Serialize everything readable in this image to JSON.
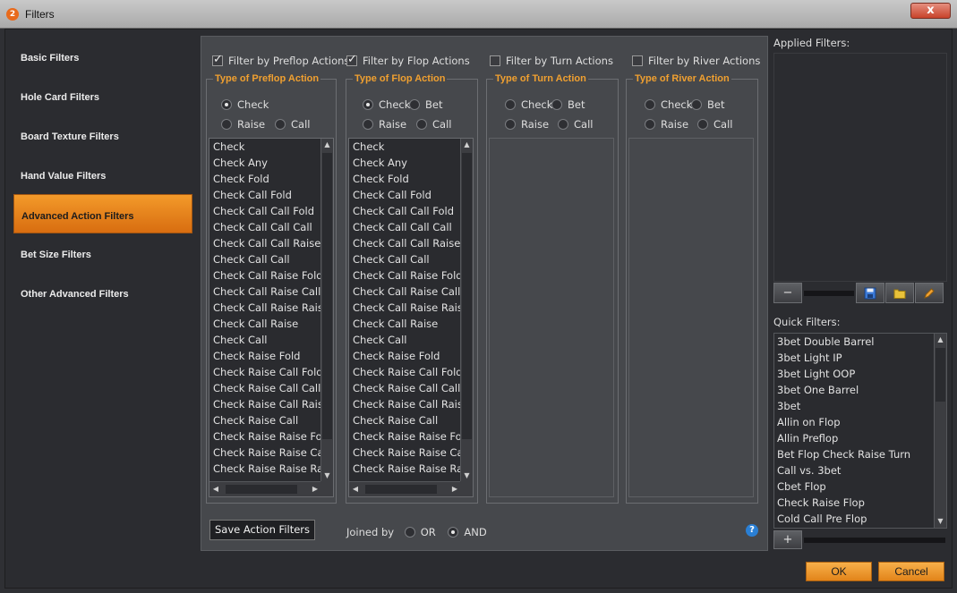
{
  "window": {
    "title": "Filters",
    "app_badge": "2",
    "close_label": "x"
  },
  "nav": {
    "items": [
      {
        "label": "Basic Filters"
      },
      {
        "label": "Hole Card Filters"
      },
      {
        "label": "Board Texture Filters"
      },
      {
        "label": "Hand Value Filters"
      },
      {
        "label": "Advanced Action Filters",
        "active": true
      },
      {
        "label": "Bet Size Filters"
      },
      {
        "label": "Other Advanced Filters"
      }
    ]
  },
  "streets": [
    {
      "checkbox_label": "Filter by Preflop Actions",
      "checked": true,
      "group_title": "Type of Preflop Action",
      "radios": [
        {
          "label": "Check",
          "selected": true
        },
        {
          "label": "Raise"
        },
        {
          "label": "Call"
        }
      ],
      "actions": [
        "Check",
        "Check Any",
        "Check Fold",
        "Check Call Fold",
        "Check Call Call Fold",
        "Check Call Call Call",
        "Check Call Call Raise",
        "Check Call Call",
        "Check Call Raise Fold",
        "Check Call Raise Call",
        "Check Call Raise Raise",
        "Check Call Raise",
        "Check Call",
        "Check Raise Fold",
        "Check Raise Call Fold",
        "Check Raise Call Call",
        "Check Raise Call Raise",
        "Check Raise Call",
        "Check Raise Raise Fold",
        "Check Raise Raise Call",
        "Check Raise Raise Raise"
      ]
    },
    {
      "checkbox_label": "Filter by Flop Actions",
      "checked": true,
      "group_title": "Type of Flop Action",
      "radios": [
        {
          "label": "Check",
          "selected": true
        },
        {
          "label": "Bet"
        },
        {
          "label": "Raise"
        },
        {
          "label": "Call"
        }
      ],
      "actions": [
        "Check",
        "Check Any",
        "Check Fold",
        "Check Call Fold",
        "Check Call Call Fold",
        "Check Call Call Call",
        "Check Call Call Raise",
        "Check Call Call",
        "Check Call Raise Fold",
        "Check Call Raise Call",
        "Check Call Raise Raise",
        "Check Call Raise",
        "Check Call",
        "Check Raise Fold",
        "Check Raise Call Fold",
        "Check Raise Call Call",
        "Check Raise Call Raise",
        "Check Raise Call",
        "Check Raise Raise Fold",
        "Check Raise Raise Call",
        "Check Raise Raise Raise"
      ]
    },
    {
      "checkbox_label": "Filter by Turn Actions",
      "checked": false,
      "group_title": "Type of Turn Action",
      "radios": [
        {
          "label": "Check"
        },
        {
          "label": "Bet"
        },
        {
          "label": "Raise"
        },
        {
          "label": "Call"
        }
      ],
      "actions": []
    },
    {
      "checkbox_label": "Filter by River Actions",
      "checked": false,
      "group_title": "Type of River Action",
      "radios": [
        {
          "label": "Check"
        },
        {
          "label": "Bet"
        },
        {
          "label": "Raise"
        },
        {
          "label": "Call"
        }
      ],
      "actions": []
    }
  ],
  "save_button": "Save Action Filters",
  "joined": {
    "label": "Joined by",
    "options": [
      {
        "label": "OR"
      },
      {
        "label": "AND",
        "selected": true
      }
    ]
  },
  "applied": {
    "label": "Applied Filters:"
  },
  "quick": {
    "label": "Quick Filters:",
    "items": [
      "3bet Double Barrel",
      "3bet Light IP",
      "3bet Light OOP",
      "3bet One Barrel",
      "3bet",
      "Allin on Flop",
      "Allin Preflop",
      "Bet Flop Check Raise Turn",
      "Call vs. 3bet",
      "Cbet Flop",
      "Check Raise Flop",
      "Cold Call Pre Flop"
    ]
  },
  "buttons": {
    "ok": "OK",
    "cancel": "Cancel",
    "remove": "−",
    "add": "+"
  },
  "colors": {
    "accent": "#f0a030",
    "active_nav": "#e8821e"
  }
}
